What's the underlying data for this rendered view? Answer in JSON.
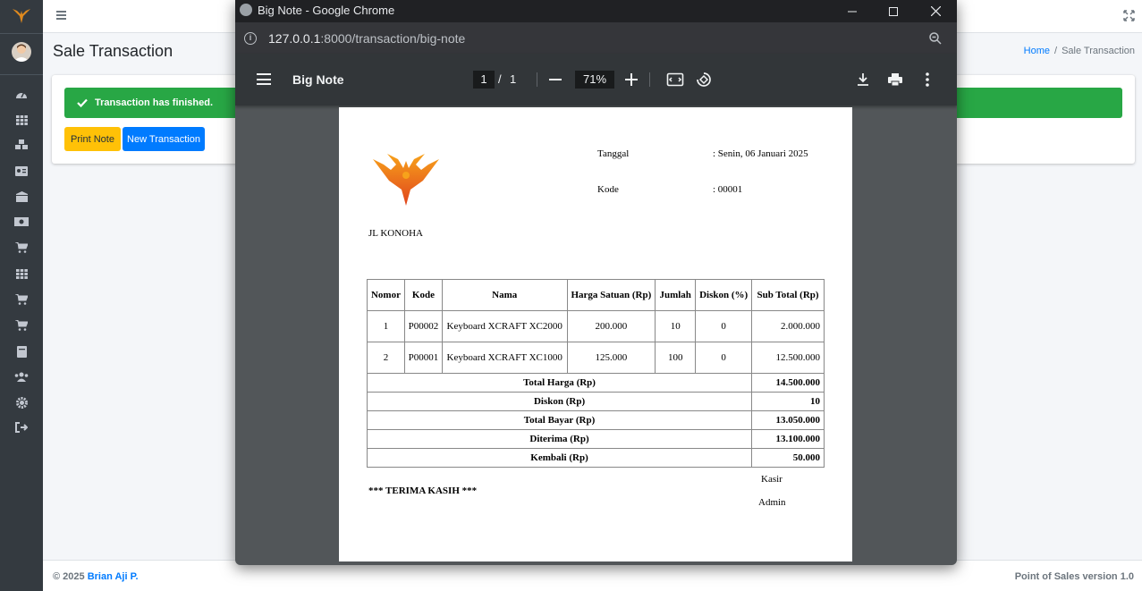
{
  "app": {
    "page_title": "Sale Transaction",
    "breadcrumb": {
      "home": "Home",
      "separator": "/",
      "current": "Sale Transaction"
    },
    "alert": {
      "message": "Transaction has finished.",
      "color": "#28a745"
    },
    "buttons": {
      "print_note": "Print Note",
      "new_transaction": "New Transaction"
    },
    "footer": {
      "copyright": "© 2025",
      "author": "Brian Aji P.",
      "version": "Point of Sales version 1.0"
    },
    "sidebar_icons": [
      "dashboard-icon",
      "grid-icon",
      "cubes-icon",
      "id-card-icon",
      "box-icon",
      "money-icon",
      "cart-icon",
      "th-icon",
      "cart-plus-icon",
      "cart-arrow-icon",
      "book-icon",
      "users-icon",
      "gear-icon",
      "sign-out-icon"
    ]
  },
  "chrome": {
    "window_title": "Big Note - Google Chrome",
    "url_host": "127.0.0.1",
    "url_rest": ":8000/transaction/big-note",
    "pdf": {
      "title": "Big Note",
      "current_page": "1",
      "page_sep": "/",
      "total_pages": "1",
      "zoom": "71%"
    }
  },
  "note": {
    "tanggal_label": "Tanggal",
    "tanggal_value": ": Senin, 06 Januari 2025",
    "kode_label": "Kode",
    "kode_value": ": 00001",
    "address": "JL KONOHA",
    "headers": [
      "Nomor",
      "Kode",
      "Nama",
      "Harga Satuan (Rp)",
      "Jumlah",
      "Diskon (%)",
      "Sub Total (Rp)"
    ],
    "rows": [
      {
        "no": "1",
        "kode": "P00002",
        "nama": "Keyboard XCRAFT XC2000",
        "harga": "200.000",
        "jumlah": "10",
        "diskon": "0",
        "subtotal": "2.000.000"
      },
      {
        "no": "2",
        "kode": "P00001",
        "nama": "Keyboard XCRAFT XC1000",
        "harga": "125.000",
        "jumlah": "100",
        "diskon": "0",
        "subtotal": "12.500.000"
      }
    ],
    "summary": [
      {
        "label": "Total Harga (Rp)",
        "value": "14.500.000"
      },
      {
        "label": "Diskon (Rp)",
        "value": "10"
      },
      {
        "label": "Total Bayar (Rp)",
        "value": "13.050.000"
      },
      {
        "label": "Diterima (Rp)",
        "value": "13.100.000"
      },
      {
        "label": "Kembali (Rp)",
        "value": "50.000"
      }
    ],
    "thanks": "*** TERIMA KASIH ***",
    "cashier_label": "Kasir",
    "cashier_name": "Admin"
  }
}
